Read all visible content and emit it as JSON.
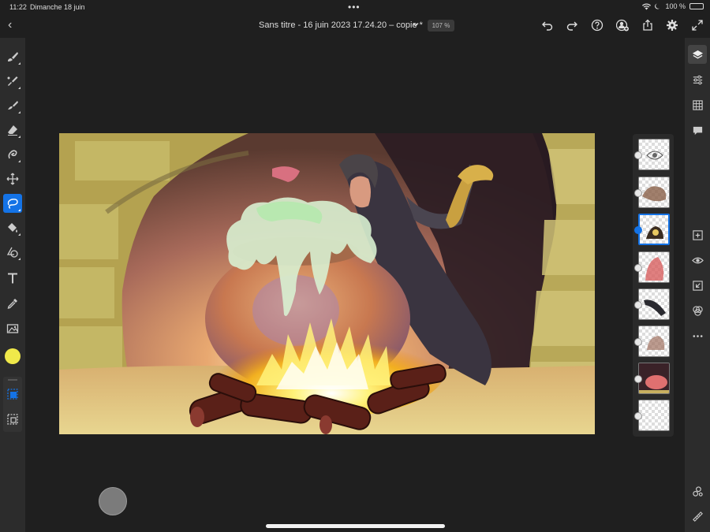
{
  "status_bar": {
    "time": "11:22",
    "date": "Dimanche 18 juin",
    "battery": "100 %"
  },
  "top_bar": {
    "document_title": "Sans titre - 16 juin 2023 17.24.20 – copie *",
    "zoom": "107 %",
    "icons": [
      "back-icon",
      "chevron-down-icon",
      "undo-icon",
      "redo-icon",
      "help-icon",
      "account-icon",
      "share-icon",
      "gear-icon",
      "fullscreen-icon"
    ]
  },
  "left_toolbar": {
    "tools": [
      "brush-icon",
      "mixer-brush-icon",
      "smudge-icon",
      "eraser-icon",
      "liquify-icon",
      "move-icon",
      "lasso-icon",
      "fill-icon",
      "shape-icon",
      "text-icon",
      "eyedropper-icon",
      "image-icon"
    ],
    "active_tool": "lasso-icon",
    "color": "#f0e94a"
  },
  "right_toolbar": {
    "icons": [
      "layers-icon",
      "adjustments-icon",
      "grid-icon",
      "comment-icon",
      "add-layer-icon",
      "visibility-icon",
      "import-icon",
      "blend-icon",
      "more-icon",
      "effects-icon",
      "ruler-icon"
    ]
  },
  "layers": {
    "count": 8,
    "active_index": 2
  },
  "colors": {
    "accent": "#1473e6",
    "panel": "#2c2c2c",
    "background": "#1f1f1f"
  }
}
